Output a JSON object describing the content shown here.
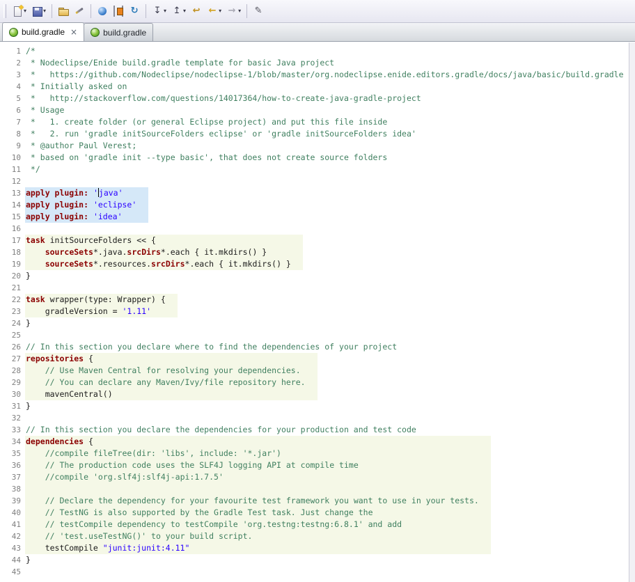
{
  "colors": {
    "keyword": "#8B0000",
    "string": "#2A00FF",
    "comment": "#3F7F5F",
    "selection": "#D5E8F8",
    "block_highlight": "#F5F8E7"
  },
  "toolbar": {
    "items": [
      {
        "name": "new-button",
        "icon": "new",
        "dropdown": true
      },
      {
        "name": "save-button",
        "icon": "save",
        "dropdown": true
      },
      {
        "sep": true
      },
      {
        "name": "open-folder-button",
        "icon": "folder"
      },
      {
        "name": "mark-occurrences-button",
        "icon": "wand"
      },
      {
        "sep": true
      },
      {
        "name": "web-browser-button",
        "icon": "globe"
      },
      {
        "name": "console-button",
        "icon": "console"
      },
      {
        "name": "refresh-button",
        "icon": "refresh",
        "glyph": "↻"
      },
      {
        "sep": true
      },
      {
        "name": "next-annotation-button",
        "icon": "next-annotation",
        "glyph": "↧",
        "dropdown": true
      },
      {
        "name": "previous-annotation-button",
        "icon": "previous-annotation",
        "glyph": "↥",
        "dropdown": true
      },
      {
        "name": "last-edit-location-button",
        "icon": "last-edit",
        "glyph": "↩"
      },
      {
        "name": "back-button",
        "icon": "back",
        "glyph": "←",
        "dropdown": true
      },
      {
        "name": "forward-button",
        "icon": "forward",
        "glyph": "→",
        "dropdown": true
      },
      {
        "sep": true
      },
      {
        "name": "pin-editor-button",
        "icon": "pin",
        "glyph": "✎"
      }
    ]
  },
  "tabs": [
    {
      "label": "build.gradle",
      "active": true,
      "close": "×"
    },
    {
      "label": "build.gradle",
      "active": false
    }
  ],
  "editor": {
    "lines": [
      {
        "n": 1,
        "bg": "",
        "seg": [
          [
            "c",
            "/*"
          ]
        ]
      },
      {
        "n": 2,
        "bg": "",
        "seg": [
          [
            "c",
            " * Nodeclipse/Enide build.gradle template for basic Java project"
          ]
        ]
      },
      {
        "n": 3,
        "bg": "",
        "seg": [
          [
            "c",
            " *   https://github.com/Nodeclipse/nodeclipse-1/blob/master/org.nodeclipse.enide.editors.gradle/docs/java/basic/build.gradle"
          ]
        ]
      },
      {
        "n": 4,
        "bg": "",
        "seg": [
          [
            "c",
            " * Initially asked on"
          ]
        ]
      },
      {
        "n": 5,
        "bg": "",
        "seg": [
          [
            "c",
            " *   http://stackoverflow.com/questions/14017364/how-to-create-java-gradle-project"
          ]
        ]
      },
      {
        "n": 6,
        "bg": "",
        "seg": [
          [
            "c",
            " * Usage"
          ]
        ]
      },
      {
        "n": 7,
        "bg": "",
        "seg": [
          [
            "c",
            " *   1. create folder (or general Eclipse project) and put this file inside"
          ]
        ]
      },
      {
        "n": 8,
        "bg": "",
        "seg": [
          [
            "c",
            " *   2. run 'gradle initSourceFolders eclipse' or 'gradle initSourceFolders idea'"
          ]
        ]
      },
      {
        "n": 9,
        "bg": "",
        "seg": [
          [
            "c",
            " * @author Paul Verest;"
          ]
        ]
      },
      {
        "n": 10,
        "bg": "",
        "seg": [
          [
            "c",
            " * based on 'gradle init --type basic', that does not create source folders"
          ]
        ]
      },
      {
        "n": 11,
        "bg": "",
        "seg": [
          [
            "c",
            " */"
          ]
        ]
      },
      {
        "n": 12,
        "bg": "",
        "seg": []
      },
      {
        "n": 13,
        "bg": "sel",
        "seg": [
          [
            "k",
            "apply plugin:"
          ],
          [
            "p",
            " "
          ],
          [
            "s",
            "'"
          ],
          [
            "cur",
            ""
          ],
          [
            "s",
            "java'"
          ]
        ]
      },
      {
        "n": 14,
        "bg": "sel",
        "seg": [
          [
            "k",
            "apply plugin:"
          ],
          [
            "p",
            " "
          ],
          [
            "s",
            "'eclipse'"
          ]
        ]
      },
      {
        "n": 15,
        "bg": "sel",
        "seg": [
          [
            "k",
            "apply plugin:"
          ],
          [
            "p",
            " "
          ],
          [
            "s",
            "'idea'"
          ]
        ]
      },
      {
        "n": 16,
        "bg": "",
        "seg": []
      },
      {
        "n": 17,
        "bg": "block",
        "seg": [
          [
            "k",
            "task"
          ],
          [
            "p",
            " initSourceFolders << {"
          ]
        ]
      },
      {
        "n": 18,
        "bg": "block",
        "seg": [
          [
            "p",
            "    "
          ],
          [
            "k",
            "sourceSets"
          ],
          [
            "p",
            "*.java."
          ],
          [
            "k",
            "srcDirs"
          ],
          [
            "p",
            "*.each { it.mkdirs() }"
          ]
        ]
      },
      {
        "n": 19,
        "bg": "block",
        "seg": [
          [
            "p",
            "    "
          ],
          [
            "k",
            "sourceSets"
          ],
          [
            "p",
            "*.resources."
          ],
          [
            "k",
            "srcDirs"
          ],
          [
            "p",
            "*.each { it.mkdirs() }"
          ]
        ]
      },
      {
        "n": 20,
        "bg": "",
        "seg": [
          [
            "p",
            "}"
          ]
        ]
      },
      {
        "n": 21,
        "bg": "",
        "seg": []
      },
      {
        "n": 22,
        "bg": "block",
        "seg": [
          [
            "k",
            "task"
          ],
          [
            "p",
            " wrapper(type: Wrapper) {"
          ]
        ]
      },
      {
        "n": 23,
        "bg": "block",
        "seg": [
          [
            "p",
            "    gradleVersion = "
          ],
          [
            "s",
            "'1.11'"
          ]
        ]
      },
      {
        "n": 24,
        "bg": "",
        "seg": [
          [
            "p",
            "}"
          ]
        ]
      },
      {
        "n": 25,
        "bg": "",
        "seg": []
      },
      {
        "n": 26,
        "bg": "",
        "seg": [
          [
            "c",
            "// In this section you declare where to find the dependencies of your project"
          ]
        ]
      },
      {
        "n": 27,
        "bg": "block",
        "seg": [
          [
            "k",
            "repositories"
          ],
          [
            "p",
            " {"
          ]
        ]
      },
      {
        "n": 28,
        "bg": "block",
        "seg": [
          [
            "p",
            "    "
          ],
          [
            "c",
            "// Use Maven Central for resolving your dependencies."
          ]
        ]
      },
      {
        "n": 29,
        "bg": "block",
        "seg": [
          [
            "p",
            "    "
          ],
          [
            "c",
            "// You can declare any Maven/Ivy/file repository here."
          ]
        ]
      },
      {
        "n": 30,
        "bg": "block",
        "seg": [
          [
            "p",
            "    mavenCentral()"
          ]
        ]
      },
      {
        "n": 31,
        "bg": "",
        "seg": [
          [
            "p",
            "}"
          ]
        ]
      },
      {
        "n": 32,
        "bg": "",
        "seg": []
      },
      {
        "n": 33,
        "bg": "",
        "seg": [
          [
            "c",
            "// In this section you declare the dependencies for your production and test code"
          ]
        ]
      },
      {
        "n": 34,
        "bg": "block",
        "seg": [
          [
            "k",
            "dependencies"
          ],
          [
            "p",
            " {"
          ]
        ]
      },
      {
        "n": 35,
        "bg": "block",
        "seg": [
          [
            "p",
            "    "
          ],
          [
            "c",
            "//compile fileTree(dir: 'libs', include: '*.jar')"
          ]
        ]
      },
      {
        "n": 36,
        "bg": "block",
        "seg": [
          [
            "p",
            "    "
          ],
          [
            "c",
            "// The production code uses the SLF4J logging API at compile time"
          ]
        ]
      },
      {
        "n": 37,
        "bg": "block",
        "seg": [
          [
            "p",
            "    "
          ],
          [
            "c",
            "//compile 'org.slf4j:slf4j-api:1.7.5'"
          ]
        ]
      },
      {
        "n": 38,
        "bg": "block",
        "seg": []
      },
      {
        "n": 39,
        "bg": "block",
        "seg": [
          [
            "p",
            "    "
          ],
          [
            "c",
            "// Declare the dependency for your favourite test framework you want to use in your tests."
          ]
        ]
      },
      {
        "n": 40,
        "bg": "block",
        "seg": [
          [
            "p",
            "    "
          ],
          [
            "c",
            "// TestNG is also supported by the Gradle Test task. Just change the"
          ]
        ]
      },
      {
        "n": 41,
        "bg": "block",
        "seg": [
          [
            "p",
            "    "
          ],
          [
            "c",
            "// testCompile dependency to testCompile 'org.testng:testng:6.8.1' and add"
          ]
        ]
      },
      {
        "n": 42,
        "bg": "block",
        "seg": [
          [
            "p",
            "    "
          ],
          [
            "c",
            "// 'test.useTestNG()' to your build script."
          ]
        ]
      },
      {
        "n": 43,
        "bg": "block",
        "seg": [
          [
            "p",
            "    testCompile "
          ],
          [
            "s",
            "\"junit:junit:4.11\""
          ]
        ]
      },
      {
        "n": 44,
        "bg": "",
        "seg": [
          [
            "p",
            "}"
          ]
        ]
      },
      {
        "n": 45,
        "bg": "",
        "seg": []
      }
    ]
  }
}
